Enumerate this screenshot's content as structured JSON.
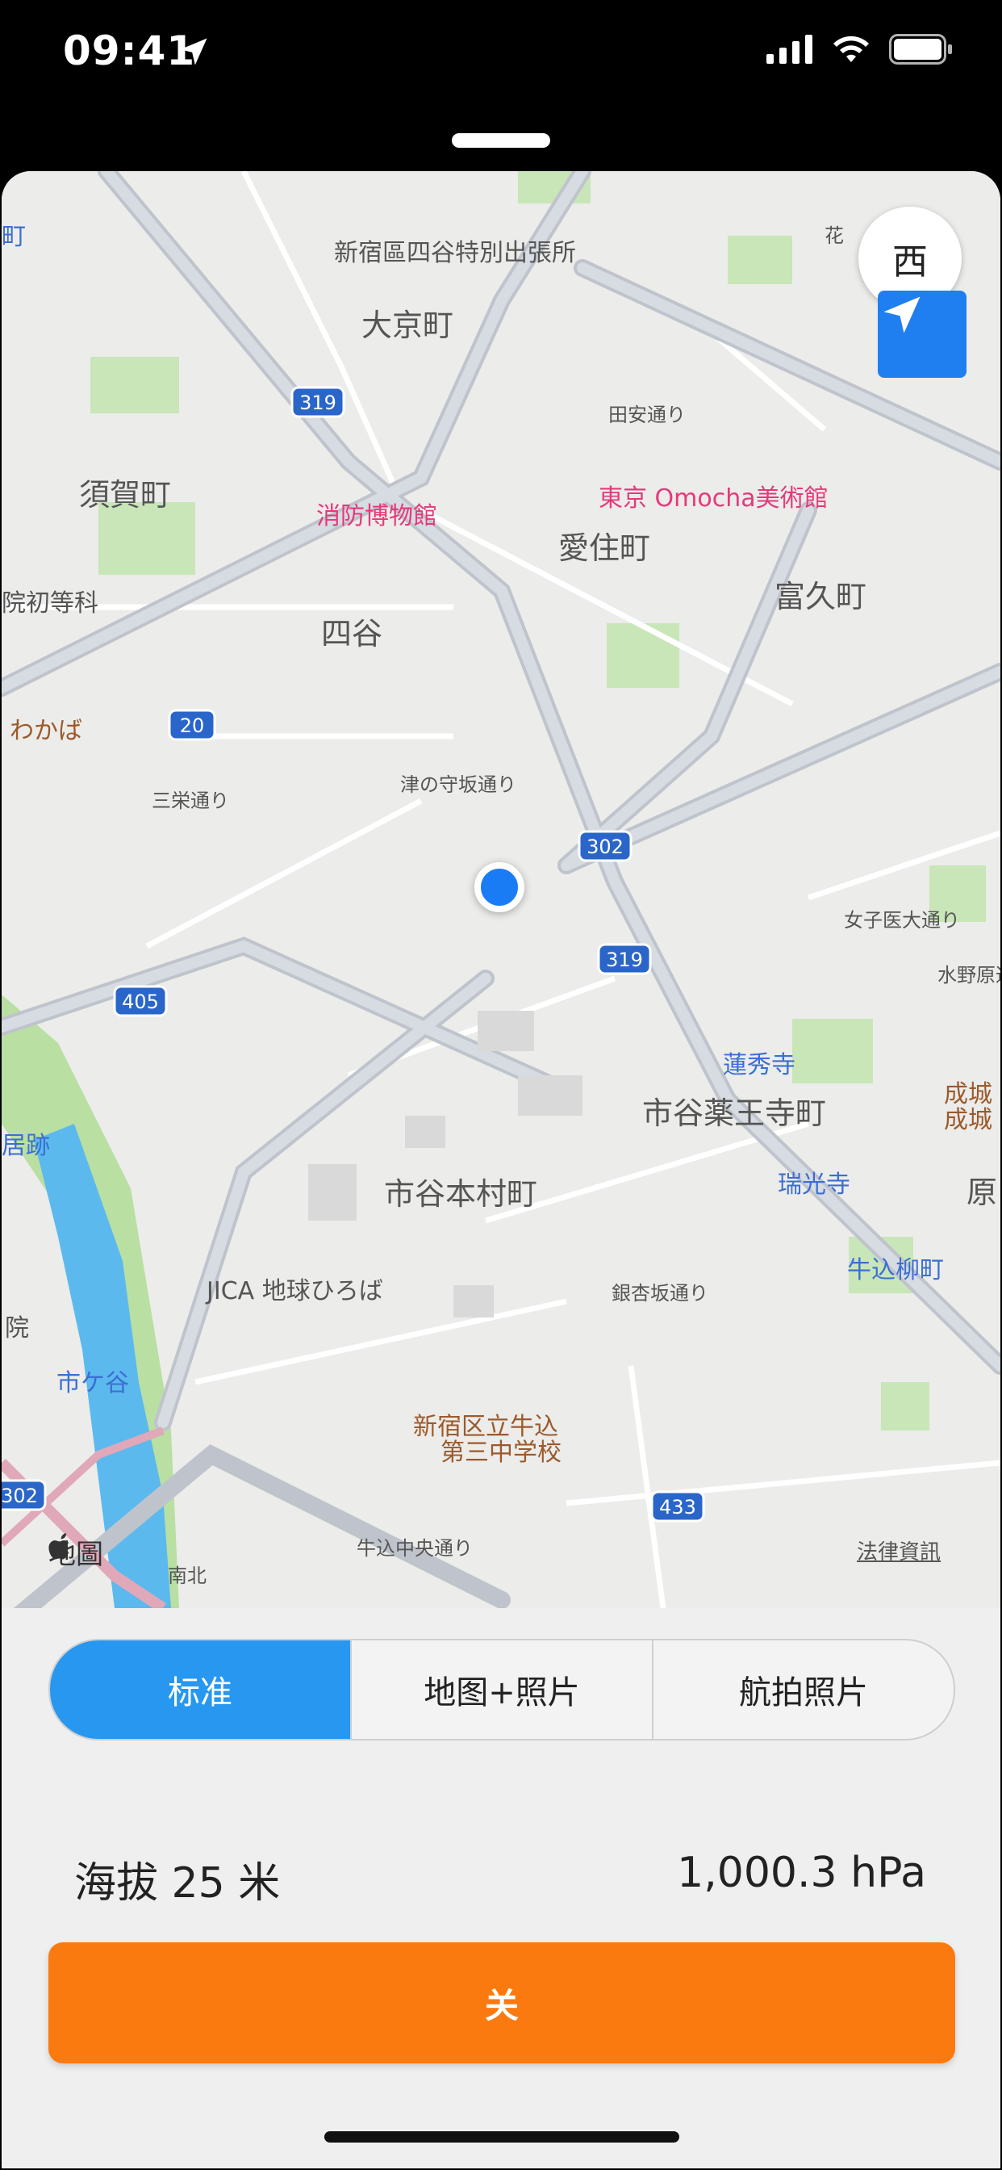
{
  "status_bar": {
    "time": "09:41"
  },
  "map": {
    "compass_label": "西",
    "attribution": "地圖",
    "legal": "法律資訊",
    "labels": {
      "shinjuku_branch": "新宿區四谷特別出張所",
      "daikyo": "大京町",
      "suga": "須賀町",
      "shobo": "消防博物館",
      "omocha": "東京 Omocha美術館",
      "aizumi": "愛住町",
      "tomihisa": "富久町",
      "yotsuya": "四谷",
      "tanan": "田安通り",
      "inshoto": "院初等科",
      "wakaba": "わかば",
      "sanei": "三栄通り",
      "tsunokami": "津の守坂通り",
      "joshi": "女子医大通り",
      "mizuno": "水野原通り",
      "renshuji": "蓮秀寺",
      "yakuoji": "市谷薬王寺町",
      "seijo": "成城",
      "seijo2": "成城",
      "zuikoji": "瑞光寺",
      "hon": "原",
      "honmura": "市谷本村町",
      "ushigome_yanagi": "牛込柳町",
      "kyoseki": "居跡",
      "jica": "JICA 地球ひろば",
      "gin": "銀杏坂通り",
      "in": "院",
      "ichigaya": "市ケ谷",
      "school1": "新宿区立牛込",
      "school2": "第三中学校",
      "ushigome_chuo": "牛込中央通り",
      "nanboku": "南北",
      "cho": "町",
      "sec_label": "花"
    },
    "route_shields": [
      "319",
      "20",
      "302",
      "319",
      "405",
      "302",
      "433"
    ]
  },
  "segments": [
    "标准",
    "地图+照片",
    "航拍照片"
  ],
  "readout": {
    "altitude": "海拔 25 米",
    "pressure": "1,000.3 hPa"
  },
  "action": {
    "off_label": "关"
  }
}
